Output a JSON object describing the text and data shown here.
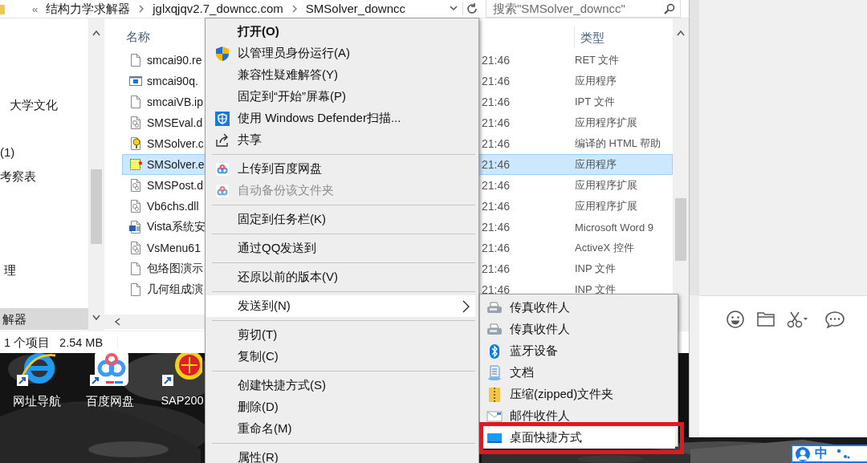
{
  "address_bar": {
    "overflow": "«",
    "breadcrumbs": [
      "结构力学求解器",
      "jglxqjqv2.7_downcc.com",
      "SMSolver_downcc"
    ],
    "search": {
      "placeholder": "搜索\"SMSolver_downcc\""
    }
  },
  "navigation_pane": {
    "items": [
      {
        "label": "大学文化",
        "selected": false
      },
      {
        "label": "(1)",
        "selected": false
      },
      {
        "label": "考察表",
        "selected": false
      },
      {
        "label": "理",
        "selected": false
      },
      {
        "label": "解器",
        "selected": true
      }
    ]
  },
  "file_list": {
    "columns": [
      "名称",
      "类型"
    ],
    "rows": [
      {
        "name": "smcai90.re",
        "time": "21:46",
        "type": "RET 文件",
        "selected": false
      },
      {
        "name": "smcai90q.",
        "time": "21:46",
        "type": "应用程序",
        "selected": false
      },
      {
        "name": "smcaiVB.ip",
        "time": "21:46",
        "type": "IPT 文件",
        "selected": false
      },
      {
        "name": "SMSEval.d",
        "time": "21:46",
        "type": "应用程序扩展",
        "selected": false
      },
      {
        "name": "SMSolver.c",
        "time": "21:46",
        "type": "编译的 HTML 帮助",
        "selected": false
      },
      {
        "name": "SMSolver.e",
        "time": "21:46",
        "type": "应用程序",
        "selected": true
      },
      {
        "name": "SMSPost.d",
        "time": "21:46",
        "type": "应用程序扩展",
        "selected": false
      },
      {
        "name": "Vb6chs.dll",
        "time": "21:46",
        "type": "应用程序扩展",
        "selected": false
      },
      {
        "name": "Vista系统安",
        "time": "21:46",
        "type": "Microsoft Word 9",
        "selected": false
      },
      {
        "name": "VsMenu61",
        "time": "21:46",
        "type": "ActiveX 控件",
        "selected": false
      },
      {
        "name": "包络图演示",
        "time": "21:46",
        "type": "INP 文件",
        "selected": false
      },
      {
        "name": "几何组成演",
        "time": "21:46",
        "type": "INP 文件",
        "selected": false
      }
    ]
  },
  "status_bar": {
    "count": "1 个项目",
    "size": "2.54 MB"
  },
  "desktop_icons": [
    {
      "label": "网址导航"
    },
    {
      "label": "百度网盘"
    },
    {
      "label": "SAP200"
    }
  ],
  "context_menu": {
    "items": [
      {
        "kind": "item",
        "label": "打开(O)",
        "default": true,
        "disabled": false,
        "selected": false,
        "submenu": false
      },
      {
        "kind": "item",
        "label": "以管理员身份运行(A)",
        "default": false,
        "disabled": false,
        "selected": false,
        "submenu": false
      },
      {
        "kind": "item",
        "label": "兼容性疑难解答(Y)",
        "default": false,
        "disabled": false,
        "selected": false,
        "submenu": false
      },
      {
        "kind": "item",
        "label": "固定到“开始”屏幕(P)",
        "default": false,
        "disabled": false,
        "selected": false,
        "submenu": false
      },
      {
        "kind": "item",
        "label": "使用 Windows Defender扫描...",
        "default": false,
        "disabled": false,
        "selected": false,
        "submenu": false
      },
      {
        "kind": "item",
        "label": "共享",
        "default": false,
        "disabled": false,
        "selected": false,
        "submenu": false
      },
      {
        "kind": "separator"
      },
      {
        "kind": "item",
        "label": "上传到百度网盘",
        "default": false,
        "disabled": false,
        "selected": false,
        "submenu": false
      },
      {
        "kind": "item",
        "label": "自动备份该文件夹",
        "default": false,
        "disabled": true,
        "selected": false,
        "submenu": false
      },
      {
        "kind": "separator"
      },
      {
        "kind": "item",
        "label": "固定到任务栏(K)",
        "default": false,
        "disabled": false,
        "selected": false,
        "submenu": false
      },
      {
        "kind": "separator"
      },
      {
        "kind": "item",
        "label": "通过QQ发送到",
        "default": false,
        "disabled": false,
        "selected": false,
        "submenu": false
      },
      {
        "kind": "separator"
      },
      {
        "kind": "item",
        "label": "还原以前的版本(V)",
        "default": false,
        "disabled": false,
        "selected": false,
        "submenu": false
      },
      {
        "kind": "separator"
      },
      {
        "kind": "item",
        "label": "发送到(N)",
        "default": false,
        "disabled": false,
        "selected": true,
        "submenu": true
      },
      {
        "kind": "separator"
      },
      {
        "kind": "item",
        "label": "剪切(T)",
        "default": false,
        "disabled": false,
        "selected": false,
        "submenu": false
      },
      {
        "kind": "item",
        "label": "复制(C)",
        "default": false,
        "disabled": false,
        "selected": false,
        "submenu": false
      },
      {
        "kind": "separator"
      },
      {
        "kind": "item",
        "label": "创建快捷方式(S)",
        "default": false,
        "disabled": false,
        "selected": false,
        "submenu": false
      },
      {
        "kind": "item",
        "label": "删除(D)",
        "default": false,
        "disabled": false,
        "selected": false,
        "submenu": false
      },
      {
        "kind": "item",
        "label": "重命名(M)",
        "default": false,
        "disabled": false,
        "selected": false,
        "submenu": false
      },
      {
        "kind": "separator"
      },
      {
        "kind": "item",
        "label": "属性(R)",
        "default": false,
        "disabled": false,
        "selected": false,
        "submenu": false
      }
    ]
  },
  "send_to_menu": {
    "items": [
      {
        "label": "传真收件人",
        "selected": false,
        "marked": false
      },
      {
        "label": "传真收件人",
        "selected": false,
        "marked": false
      },
      {
        "label": "蓝牙设备",
        "selected": false,
        "marked": false
      },
      {
        "label": "文档",
        "selected": false,
        "marked": false
      },
      {
        "label": "压缩(zipped)文件夹",
        "selected": false,
        "marked": false
      },
      {
        "label": "邮件收件人",
        "selected": false,
        "marked": false
      },
      {
        "label": "桌面快捷方式",
        "selected": true,
        "marked": true
      }
    ]
  },
  "tray": {
    "input_method": "中"
  }
}
